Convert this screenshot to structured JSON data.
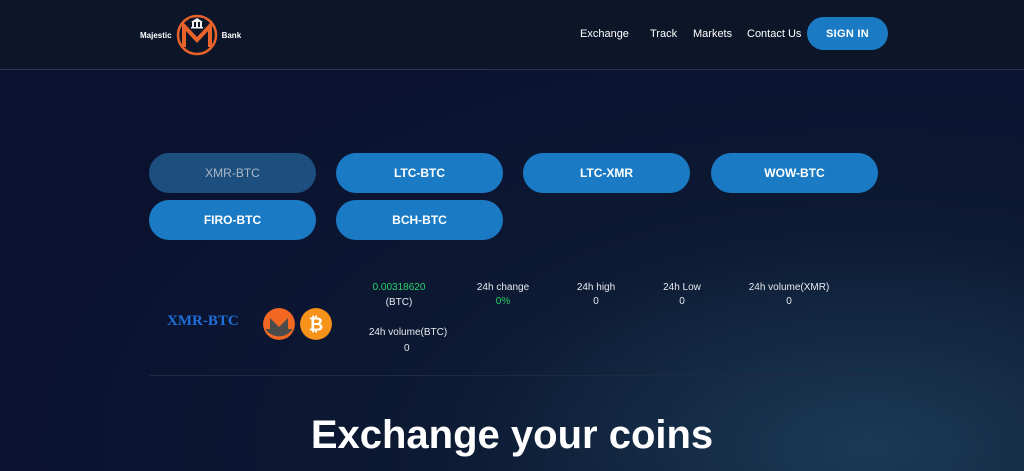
{
  "header": {
    "logo_left": "Majestic",
    "logo_right": "Bank",
    "nav": [
      "Exchange",
      "Track",
      "Markets",
      "Contact Us"
    ],
    "signin": "SIGN IN"
  },
  "pairs": [
    "XMR-BTC",
    "LTC-BTC",
    "LTC-XMR",
    "WOW-BTC",
    "FIRO-BTC",
    "BCH-BTC"
  ],
  "ticker": {
    "name": "XMR-BTC",
    "price": "0.00318620",
    "price_unit": "(BTC)",
    "change_label": "24h change",
    "change_value": "0%",
    "high_label": "24h high",
    "high_value": "0",
    "low_label": "24h Low",
    "low_value": "0",
    "vol_xmr_label": "24h volume(XMR)",
    "vol_xmr_value": "0",
    "vol_btc_label": "24h volume(BTC)",
    "vol_btc_value": "0"
  },
  "hero": {
    "title": "Exchange your coins"
  },
  "colors": {
    "accent": "#1a7bc4",
    "active_pair": "#1c4e7e",
    "positive": "#2bd16a",
    "ticker_name": "#1e6fd9"
  }
}
